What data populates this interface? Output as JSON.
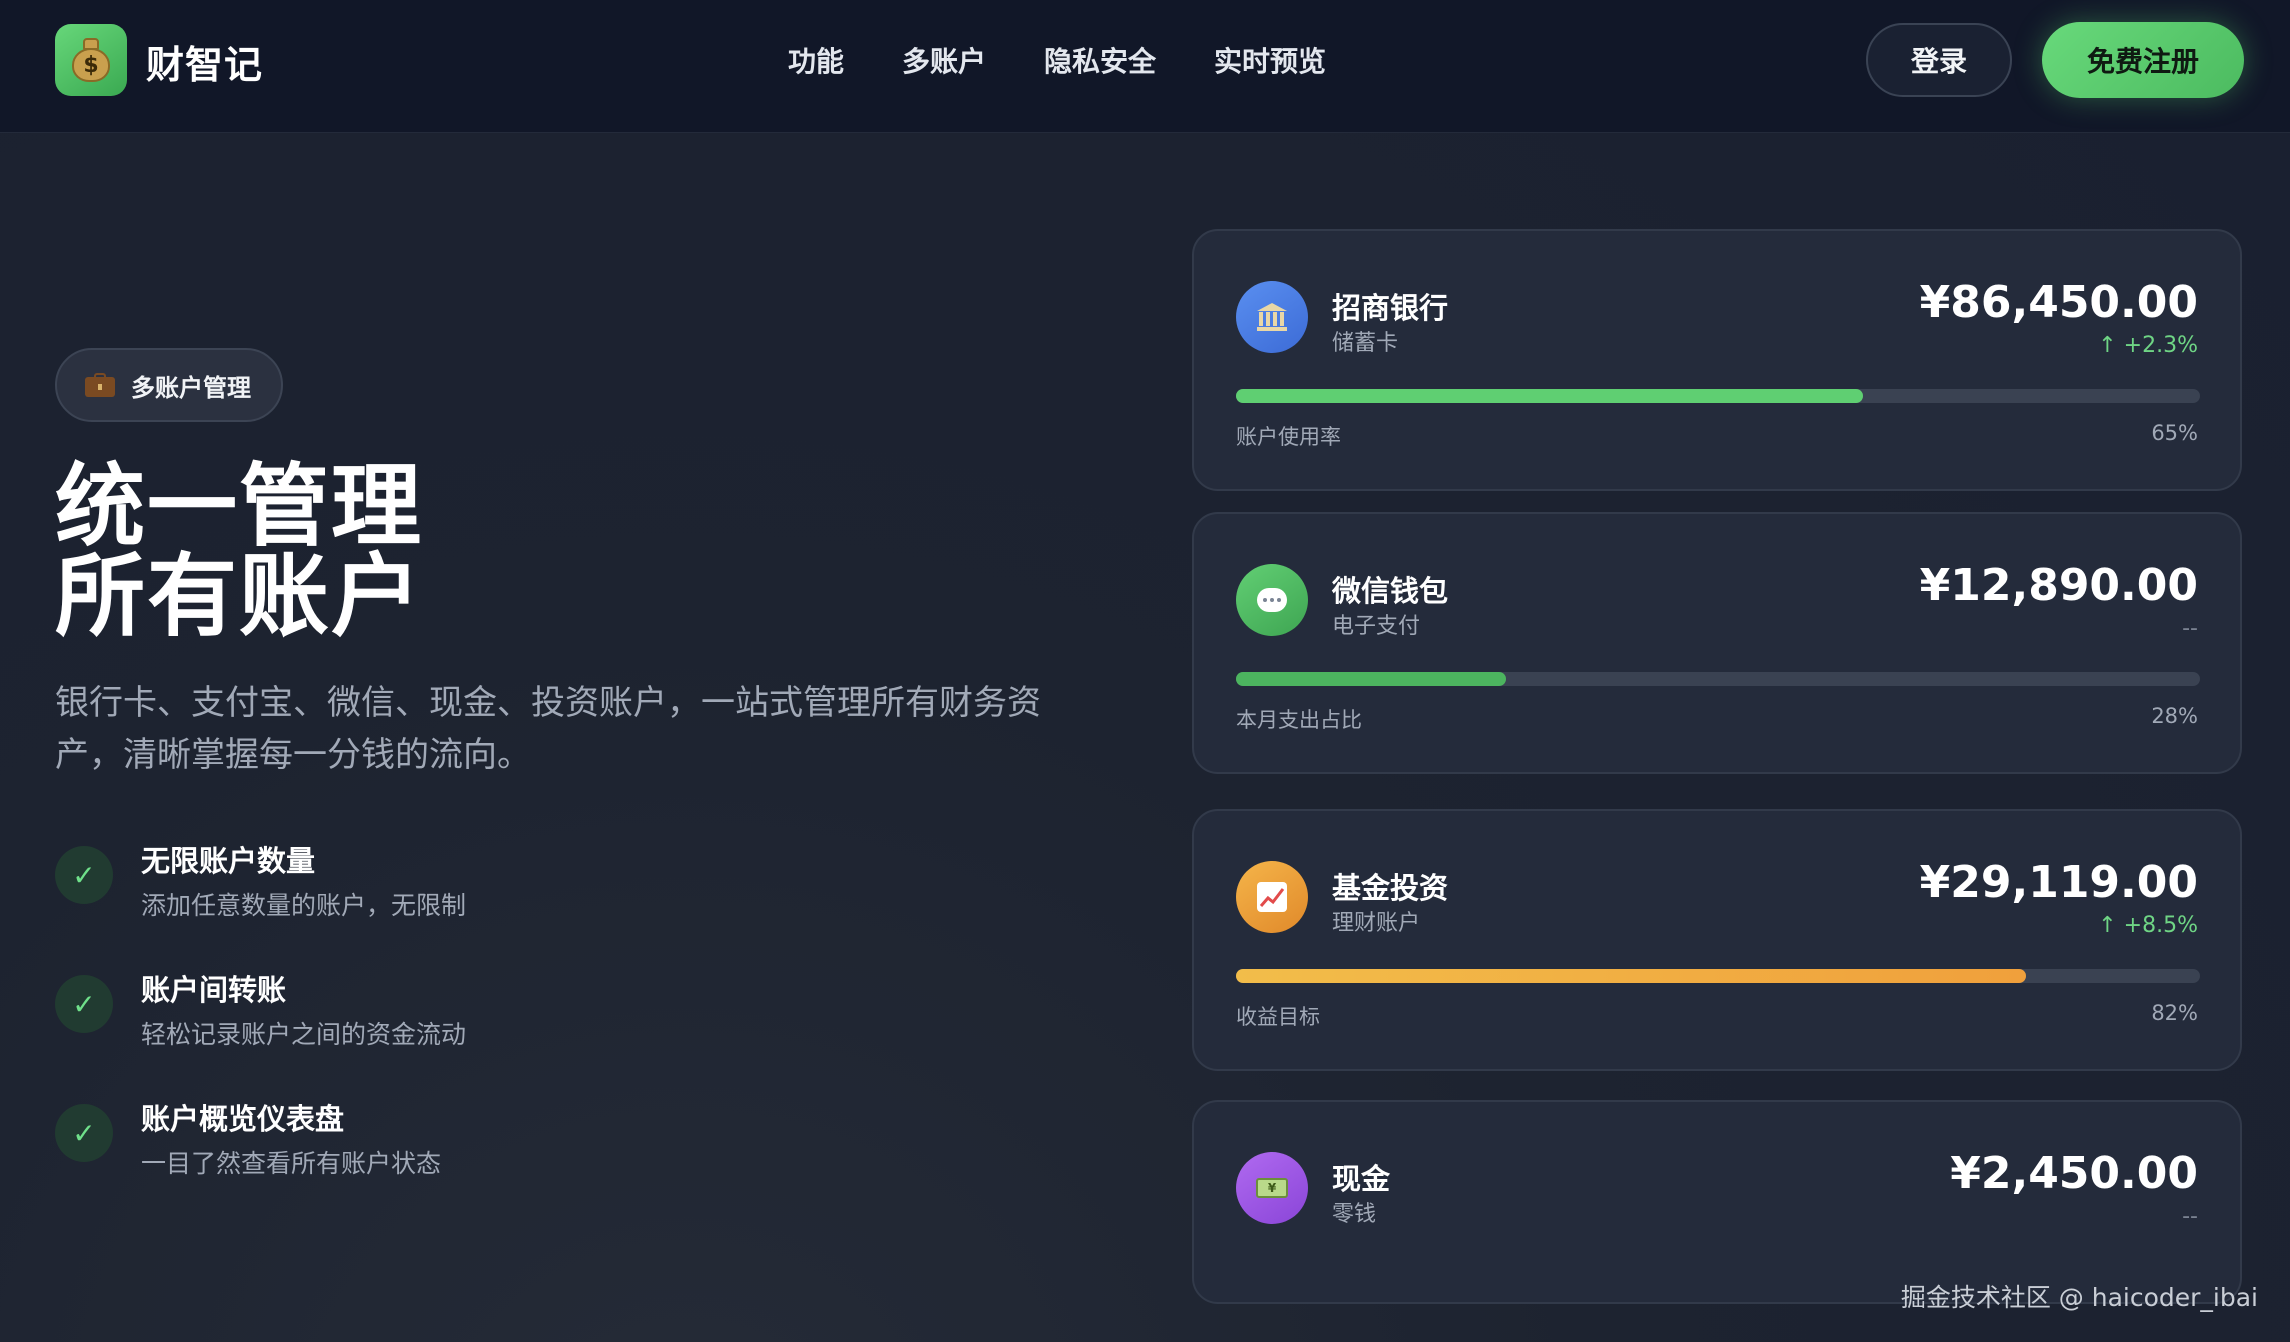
{
  "nav": {
    "brand": "财智记",
    "links": [
      "功能",
      "多账户",
      "隐私安全",
      "实时预览"
    ],
    "login": "登录",
    "signup": "免费注册"
  },
  "hero": {
    "badge": "多账户管理",
    "title_line1": "统一管理",
    "title_line2": "所有账户",
    "desc_line1": "银行卡、支付宝、微信、现金、投资账户，一站式管理所有财务资",
    "desc_line2": "产，清晰掌握每一分钱的流向。",
    "features": [
      {
        "title": "无限账户数量",
        "desc": "添加任意数量的账户，无限制"
      },
      {
        "title": "账户间转账",
        "desc": "轻松记录账户之间的资金流动"
      },
      {
        "title": "账户概览仪表盘",
        "desc": "一目了然查看所有账户状态"
      }
    ]
  },
  "accounts": [
    {
      "name": "招商银行",
      "type": "储蓄卡",
      "amount": "¥86,450.00",
      "change": "↑ +2.3%",
      "bar_label": "账户使用率",
      "bar_pct": "65%",
      "bar_fraction": 0.65,
      "icon": "bank-icon",
      "icon_color": "#4a7fe6"
    },
    {
      "name": "微信钱包",
      "type": "电子支付",
      "amount": "¥12,890.00",
      "change": "--",
      "bar_label": "本月支出占比",
      "bar_pct": "28%",
      "bar_fraction": 0.28,
      "icon": "chat-bubble-icon",
      "icon_color": "#4cb45f"
    },
    {
      "name": "基金投资",
      "type": "理财账户",
      "amount": "¥29,119.00",
      "change": "↑ +8.5%",
      "bar_label": "收益目标",
      "bar_pct": "82%",
      "bar_fraction": 0.82,
      "icon": "chart-up-icon",
      "icon_color": "#f0a23c"
    },
    {
      "name": "现金",
      "type": "零钱",
      "amount": "¥2,450.00",
      "change": "--",
      "icon": "cash-icon",
      "icon_color": "#9b59e6"
    }
  ],
  "watermark": "掘金技术社区 @ haicoder_ibai"
}
